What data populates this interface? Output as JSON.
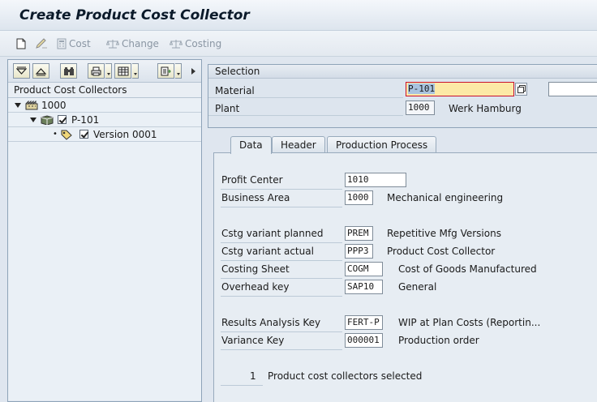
{
  "window": {
    "title": "Create Product Cost Collector"
  },
  "toolbar": {
    "cost_label": "Cost",
    "change_label": "Change",
    "costing_label": "Costing"
  },
  "tree": {
    "header": "Product Cost Collectors",
    "nodes": [
      {
        "label": "1000",
        "icon": "plant-icon"
      },
      {
        "label": "P-101",
        "icon": "material-icon"
      },
      {
        "label": "Version 0001",
        "icon": "version-icon"
      }
    ]
  },
  "selection": {
    "title": "Selection",
    "material_label": "Material",
    "material_value": "P-101",
    "plant_label": "Plant",
    "plant_value": "1000",
    "plant_text": "Werk Hamburg"
  },
  "tabs": [
    {
      "label": "Data"
    },
    {
      "label": "Header"
    },
    {
      "label": "Production Process"
    }
  ],
  "data_tab": {
    "profit_center_label": "Profit Center",
    "profit_center_value": "1010",
    "business_area_label": "Business Area",
    "business_area_value": "1000",
    "business_area_text": "Mechanical engineering",
    "cstg_planned_label": "Cstg variant planned",
    "cstg_planned_value": "PREM",
    "cstg_planned_text": "Repetitive Mfg Versions",
    "cstg_actual_label": "Cstg variant actual",
    "cstg_actual_value": "PPP3",
    "cstg_actual_text": "Product Cost Collector",
    "costing_sheet_label": "Costing Sheet",
    "costing_sheet_value": "COGM",
    "costing_sheet_text": "Cost of Goods Manufactured",
    "overhead_key_label": "Overhead key",
    "overhead_key_value": "SAP10",
    "overhead_key_text": "General",
    "ra_key_label": "Results Analysis Key",
    "ra_key_value": "FERT-P",
    "ra_key_text": "WIP at Plan Costs (Reportin...",
    "variance_key_label": "Variance Key",
    "variance_key_value": "000001",
    "variance_key_text": "Production order",
    "count_value": "1",
    "count_text": "Product cost collectors selected"
  },
  "colors": {
    "highlight_field": "#fce9a6",
    "selected_text_bg": "#a9c3df",
    "focus_border": "#c8102e"
  }
}
